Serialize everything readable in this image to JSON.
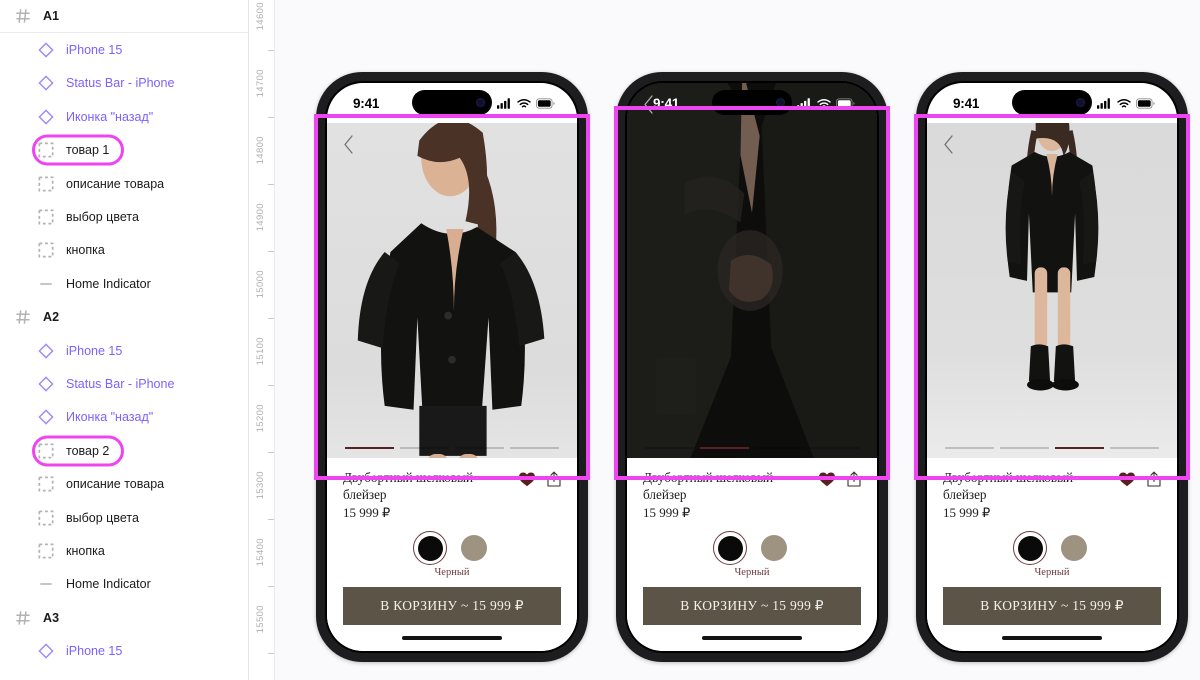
{
  "layers_panel": {
    "rows": [
      {
        "label": "A1",
        "icon": "hash-icon",
        "type": "frame",
        "depth": 0,
        "selected": false,
        "divider": true
      },
      {
        "label": "iPhone 15",
        "icon": "diamond-icon",
        "type": "instance",
        "depth": 1,
        "selected": false,
        "divider": false
      },
      {
        "label": "Status Bar - iPhone",
        "icon": "diamond-icon",
        "type": "instance",
        "depth": 1,
        "selected": false,
        "divider": false
      },
      {
        "label": "Иконка \"назад\"",
        "icon": "diamond-icon",
        "type": "instance",
        "depth": 1,
        "selected": false,
        "divider": false
      },
      {
        "label": "товар 1",
        "icon": "group-icon",
        "type": "group",
        "depth": 1,
        "selected": true,
        "divider": false
      },
      {
        "label": "описание товара",
        "icon": "group-icon",
        "type": "group",
        "depth": 1,
        "selected": false,
        "divider": false
      },
      {
        "label": "выбор цвета",
        "icon": "group-icon",
        "type": "group",
        "depth": 1,
        "selected": false,
        "divider": false
      },
      {
        "label": "кнопка",
        "icon": "group-icon",
        "type": "group",
        "depth": 1,
        "selected": false,
        "divider": false
      },
      {
        "label": "Home Indicator",
        "icon": "dash-icon",
        "type": "layer",
        "depth": 1,
        "selected": false,
        "divider": false
      },
      {
        "label": "A2",
        "icon": "hash-icon",
        "type": "frame",
        "depth": 0,
        "selected": false,
        "divider": false
      },
      {
        "label": "iPhone 15",
        "icon": "diamond-icon",
        "type": "instance",
        "depth": 1,
        "selected": false,
        "divider": false
      },
      {
        "label": "Status Bar - iPhone",
        "icon": "diamond-icon",
        "type": "instance",
        "depth": 1,
        "selected": false,
        "divider": false
      },
      {
        "label": "Иконка \"назад\"",
        "icon": "diamond-icon",
        "type": "instance",
        "depth": 1,
        "selected": false,
        "divider": false
      },
      {
        "label": "товар 2",
        "icon": "group-icon",
        "type": "group",
        "depth": 1,
        "selected": true,
        "divider": false
      },
      {
        "label": "описание товара",
        "icon": "group-icon",
        "type": "group",
        "depth": 1,
        "selected": false,
        "divider": false
      },
      {
        "label": "выбор цвета",
        "icon": "group-icon",
        "type": "group",
        "depth": 1,
        "selected": false,
        "divider": false
      },
      {
        "label": "кнопка",
        "icon": "group-icon",
        "type": "group",
        "depth": 1,
        "selected": false,
        "divider": false
      },
      {
        "label": "Home Indicator",
        "icon": "dash-icon",
        "type": "layer",
        "depth": 1,
        "selected": false,
        "divider": false
      },
      {
        "label": "A3",
        "icon": "hash-icon",
        "type": "frame",
        "depth": 0,
        "selected": false,
        "divider": false
      },
      {
        "label": "iPhone 15",
        "icon": "diamond-icon",
        "type": "instance",
        "depth": 1,
        "selected": false,
        "divider": false
      }
    ]
  },
  "ruler": {
    "labels": [
      "14600",
      "14700",
      "14800",
      "14900",
      "15000",
      "15100",
      "15200",
      "15300",
      "15400",
      "15500"
    ],
    "tops": [
      50,
      117,
      184,
      251,
      318,
      385,
      452,
      519,
      586,
      653
    ]
  },
  "colors": {
    "selection_magenta": "#ef45f0",
    "component_purple": "#7b61ff",
    "cart_button": "#5c5547",
    "swatch_black": "#0a0a0a",
    "swatch_beige": "#9e9280",
    "accent_wine": "#6d3a40",
    "heart_red": "#5a1f20",
    "canvas_bg": "#fafafc"
  },
  "phones": [
    {
      "id": "phone-a1",
      "status_bar": {
        "time": "9:41",
        "theme": "dark",
        "signal_icon": "cellular-icon",
        "wifi_icon": "wifi-icon",
        "battery_icon": "battery-icon"
      },
      "back_icon": "chevron-left-icon",
      "image_variant": "model-front-light",
      "carousel": {
        "count": 4,
        "active_index": 0
      },
      "product": {
        "title": "Двубортный шелковый блейзер",
        "price": "15 999 ₽",
        "favorite_icon": "heart-filled-icon",
        "share_icon": "share-icon",
        "colors": [
          {
            "name": "Черный",
            "hex": "#0a0a0a",
            "selected": true
          },
          {
            "name": "Бежевый",
            "hex": "#9e9280",
            "selected": false
          }
        ],
        "selected_color_label": "Черный",
        "cart_button_label": "В КОРЗИНУ ~ 15 999 ₽"
      }
    },
    {
      "id": "phone-a2",
      "status_bar": {
        "time": "9:41",
        "theme": "dark",
        "signal_icon": "cellular-icon",
        "wifi_icon": "wifi-icon",
        "battery_icon": "battery-icon"
      },
      "back_icon": "chevron-left-icon",
      "image_variant": "blazer-closeup-dark",
      "carousel": {
        "count": 4,
        "active_index": 1
      },
      "product": {
        "title": "Двубортный шелковый блейзер",
        "price": "15 999 ₽",
        "favorite_icon": "heart-filled-icon",
        "share_icon": "share-icon",
        "colors": [
          {
            "name": "Черный",
            "hex": "#0a0a0a",
            "selected": true
          },
          {
            "name": "Бежевый",
            "hex": "#9e9280",
            "selected": false
          }
        ],
        "selected_color_label": "Черный",
        "cart_button_label": "В КОРЗИНУ ~ 15 999 ₽"
      }
    },
    {
      "id": "phone-a3",
      "status_bar": {
        "time": "9:41",
        "theme": "dark",
        "signal_icon": "cellular-icon",
        "wifi_icon": "wifi-icon",
        "battery_icon": "battery-icon"
      },
      "back_icon": "chevron-left-icon",
      "image_variant": "model-fullbody-light",
      "carousel": {
        "count": 4,
        "active_index": 2
      },
      "product": {
        "title": "Двубортный шелковый блейзер",
        "price": "15 999 ₽",
        "favorite_icon": "heart-filled-icon",
        "share_icon": "share-icon",
        "colors": [
          {
            "name": "Черный",
            "hex": "#0a0a0a",
            "selected": true
          },
          {
            "name": "Бежевый",
            "hex": "#9e9280",
            "selected": false
          }
        ],
        "selected_color_label": "Черный",
        "cart_button_label": "В КОРЗИНУ ~ 15 999 ₽"
      }
    }
  ]
}
